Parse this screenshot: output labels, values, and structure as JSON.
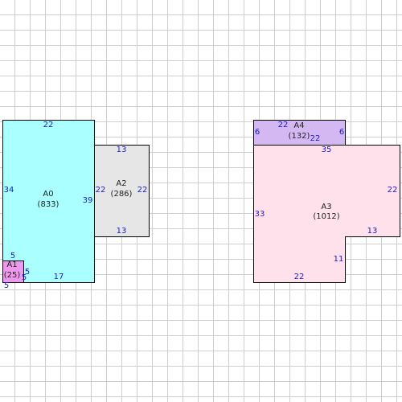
{
  "colors": {
    "A0": "#aaffff",
    "A1": "#ee99ee",
    "A2": "#e6e6e6",
    "A3": "#ffe1ec",
    "A4": "#d4b8f2",
    "dimension_text": "#1a1ad6",
    "outline": "#000000",
    "grid": "#cfcfcf"
  },
  "rooms": {
    "A0": {
      "name": "A0",
      "area": "(833)"
    },
    "A1": {
      "name": "A1",
      "area": "(25)"
    },
    "A2": {
      "name": "A2",
      "area": "(286)"
    },
    "A3": {
      "name": "A3",
      "area": "(1012)"
    },
    "A4": {
      "name": "A4",
      "area": "(132)"
    }
  },
  "dimensions": {
    "A0": {
      "top": "22",
      "left": "34",
      "right": "39",
      "bottom": "17",
      "left_lower": "5"
    },
    "A1": {
      "top": "5",
      "right": "5",
      "bottom": "5"
    },
    "A2": {
      "top": "13",
      "left": "22",
      "right": "22",
      "bottom": "13"
    },
    "A3": {
      "top": "35",
      "left": "33",
      "right": "22",
      "notch_top": "13",
      "notch_side": "11",
      "bottom": "22"
    },
    "A4": {
      "top": "22",
      "left": "6",
      "right": "6",
      "bottom": "22"
    }
  }
}
